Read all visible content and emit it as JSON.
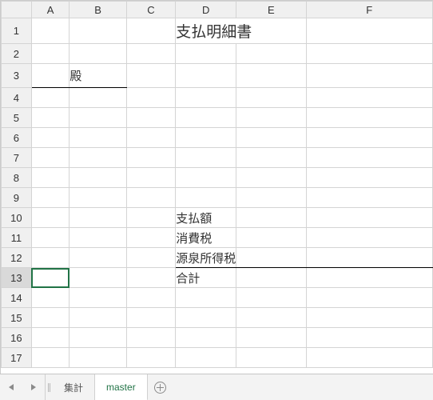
{
  "columns": [
    "A",
    "B",
    "C",
    "D",
    "E",
    "F"
  ],
  "rows_count": 17,
  "selected_row": 13,
  "cells": {
    "title_de": "支払明細書",
    "b3": "殿",
    "d10": "支払額",
    "d11": "消費税",
    "d12": "源泉所得税",
    "d13": "合計"
  },
  "tabs": {
    "tab1": "集計",
    "tab2": "master"
  },
  "active_tab": 2
}
